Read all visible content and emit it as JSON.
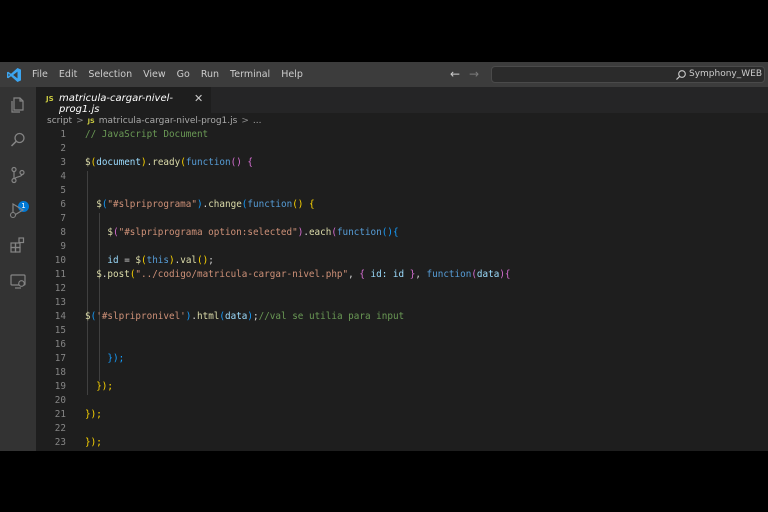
{
  "menu": [
    "File",
    "Edit",
    "Selection",
    "View",
    "Go",
    "Run",
    "Terminal",
    "Help"
  ],
  "nav": {
    "back_icon": "arrow-left-icon",
    "forward_icon": "arrow-right-icon",
    "back": "←",
    "forward": "→"
  },
  "search": {
    "text": "Symphony_WEB",
    "icon": "search-icon"
  },
  "activity_icons": [
    "explorer-icon",
    "search-icon",
    "source-control-icon",
    "run-debug-icon",
    "extensions-icon",
    "remote-explorer-icon"
  ],
  "scm_badge": "1",
  "tab": {
    "label": "matricula-cargar-nivel-prog1.js",
    "lang": "JS",
    "close": "✕"
  },
  "breadcrumb": {
    "folder": "script",
    "lang": "JS",
    "file": "matricula-cargar-nivel-prog1.js",
    "more": "..."
  },
  "colors": {
    "comment": "#6a9955",
    "default": "#d4d4d4",
    "function": "#dcdcaa",
    "string": "#ce9178",
    "keyword": "#569cd6",
    "variable": "#9cdcfe",
    "bracket1": "#ffd700",
    "bracket2": "#da70d6",
    "bracket3": "#179fff",
    "accent": "#0078d4"
  },
  "code_lines": [
    {
      "n": "1",
      "tokens": [
        [
          "// JavaScript Document",
          "comment"
        ]
      ]
    },
    {
      "n": "2",
      "tokens": []
    },
    {
      "n": "3",
      "tokens": [
        [
          "$",
          "function"
        ],
        [
          "(",
          "bracket1"
        ],
        [
          "document",
          "variable"
        ],
        [
          ")",
          "bracket1"
        ],
        [
          ".",
          "default"
        ],
        [
          "ready",
          "function"
        ],
        [
          "(",
          "bracket1"
        ],
        [
          "function",
          "keyword"
        ],
        [
          "()",
          "bracket2"
        ],
        [
          " ",
          "default"
        ],
        [
          "{",
          "bracket2"
        ]
      ]
    },
    {
      "n": "4",
      "tokens": []
    },
    {
      "n": "5",
      "tokens": []
    },
    {
      "n": "6",
      "tokens": [
        [
          "  ",
          "default"
        ],
        [
          "$",
          "function"
        ],
        [
          "(",
          "bracket3"
        ],
        [
          "\"#slpriprograma\"",
          "string"
        ],
        [
          ")",
          "bracket3"
        ],
        [
          ".",
          "default"
        ],
        [
          "change",
          "function"
        ],
        [
          "(",
          "bracket3"
        ],
        [
          "function",
          "keyword"
        ],
        [
          "()",
          "bracket1"
        ],
        [
          " ",
          "default"
        ],
        [
          "{",
          "bracket1"
        ]
      ]
    },
    {
      "n": "7",
      "tokens": []
    },
    {
      "n": "8",
      "tokens": [
        [
          "    ",
          "default"
        ],
        [
          "$",
          "function"
        ],
        [
          "(",
          "bracket2"
        ],
        [
          "\"#slpriprograma option:selected\"",
          "string"
        ],
        [
          ")",
          "bracket2"
        ],
        [
          ".",
          "default"
        ],
        [
          "each",
          "function"
        ],
        [
          "(",
          "bracket2"
        ],
        [
          "function",
          "keyword"
        ],
        [
          "()",
          "bracket3"
        ],
        [
          "{",
          "bracket3"
        ]
      ]
    },
    {
      "n": "9",
      "tokens": []
    },
    {
      "n": "10",
      "tokens": [
        [
          "    ",
          "default"
        ],
        [
          "id",
          "variable"
        ],
        [
          " = ",
          "default"
        ],
        [
          "$",
          "function"
        ],
        [
          "(",
          "bracket1"
        ],
        [
          "this",
          "keyword"
        ],
        [
          ")",
          "bracket1"
        ],
        [
          ".",
          "default"
        ],
        [
          "val",
          "function"
        ],
        [
          "()",
          "bracket1"
        ],
        [
          ";",
          "default"
        ]
      ]
    },
    {
      "n": "11",
      "tokens": [
        [
          "  ",
          "default"
        ],
        [
          "$",
          "function"
        ],
        [
          ".",
          "default"
        ],
        [
          "post",
          "function"
        ],
        [
          "(",
          "bracket1"
        ],
        [
          "\"../codigo/matricula-cargar-nivel.php\"",
          "string"
        ],
        [
          ", ",
          "default"
        ],
        [
          "{",
          "bracket2"
        ],
        [
          " id: id ",
          "variable"
        ],
        [
          "}",
          "bracket2"
        ],
        [
          ", ",
          "default"
        ],
        [
          "function",
          "keyword"
        ],
        [
          "(",
          "bracket2"
        ],
        [
          "data",
          "variable"
        ],
        [
          ")",
          "bracket2"
        ],
        [
          "{",
          "bracket2"
        ]
      ]
    },
    {
      "n": "12",
      "tokens": []
    },
    {
      "n": "13",
      "tokens": []
    },
    {
      "n": "14",
      "tokens": [
        [
          "$",
          "function"
        ],
        [
          "(",
          "bracket3"
        ],
        [
          "'#slpripronivel'",
          "string"
        ],
        [
          ")",
          "bracket3"
        ],
        [
          ".",
          "default"
        ],
        [
          "html",
          "function"
        ],
        [
          "(",
          "bracket3"
        ],
        [
          "data",
          "variable"
        ],
        [
          ")",
          "bracket3"
        ],
        [
          ";",
          "default"
        ],
        [
          "//val se utilia para input",
          "comment"
        ]
      ]
    },
    {
      "n": "15",
      "tokens": []
    },
    {
      "n": "16",
      "tokens": []
    },
    {
      "n": "17",
      "tokens": [
        [
          "    ",
          "default"
        ],
        [
          "});",
          "bracket3"
        ]
      ]
    },
    {
      "n": "18",
      "tokens": []
    },
    {
      "n": "19",
      "tokens": [
        [
          "  ",
          "default"
        ],
        [
          "});",
          "bracket1"
        ]
      ]
    },
    {
      "n": "20",
      "tokens": []
    },
    {
      "n": "21",
      "tokens": [
        [
          "});",
          "bracket1"
        ]
      ]
    },
    {
      "n": "22",
      "tokens": []
    },
    {
      "n": "23",
      "tokens": [
        [
          "});",
          "bracket1"
        ]
      ]
    }
  ]
}
